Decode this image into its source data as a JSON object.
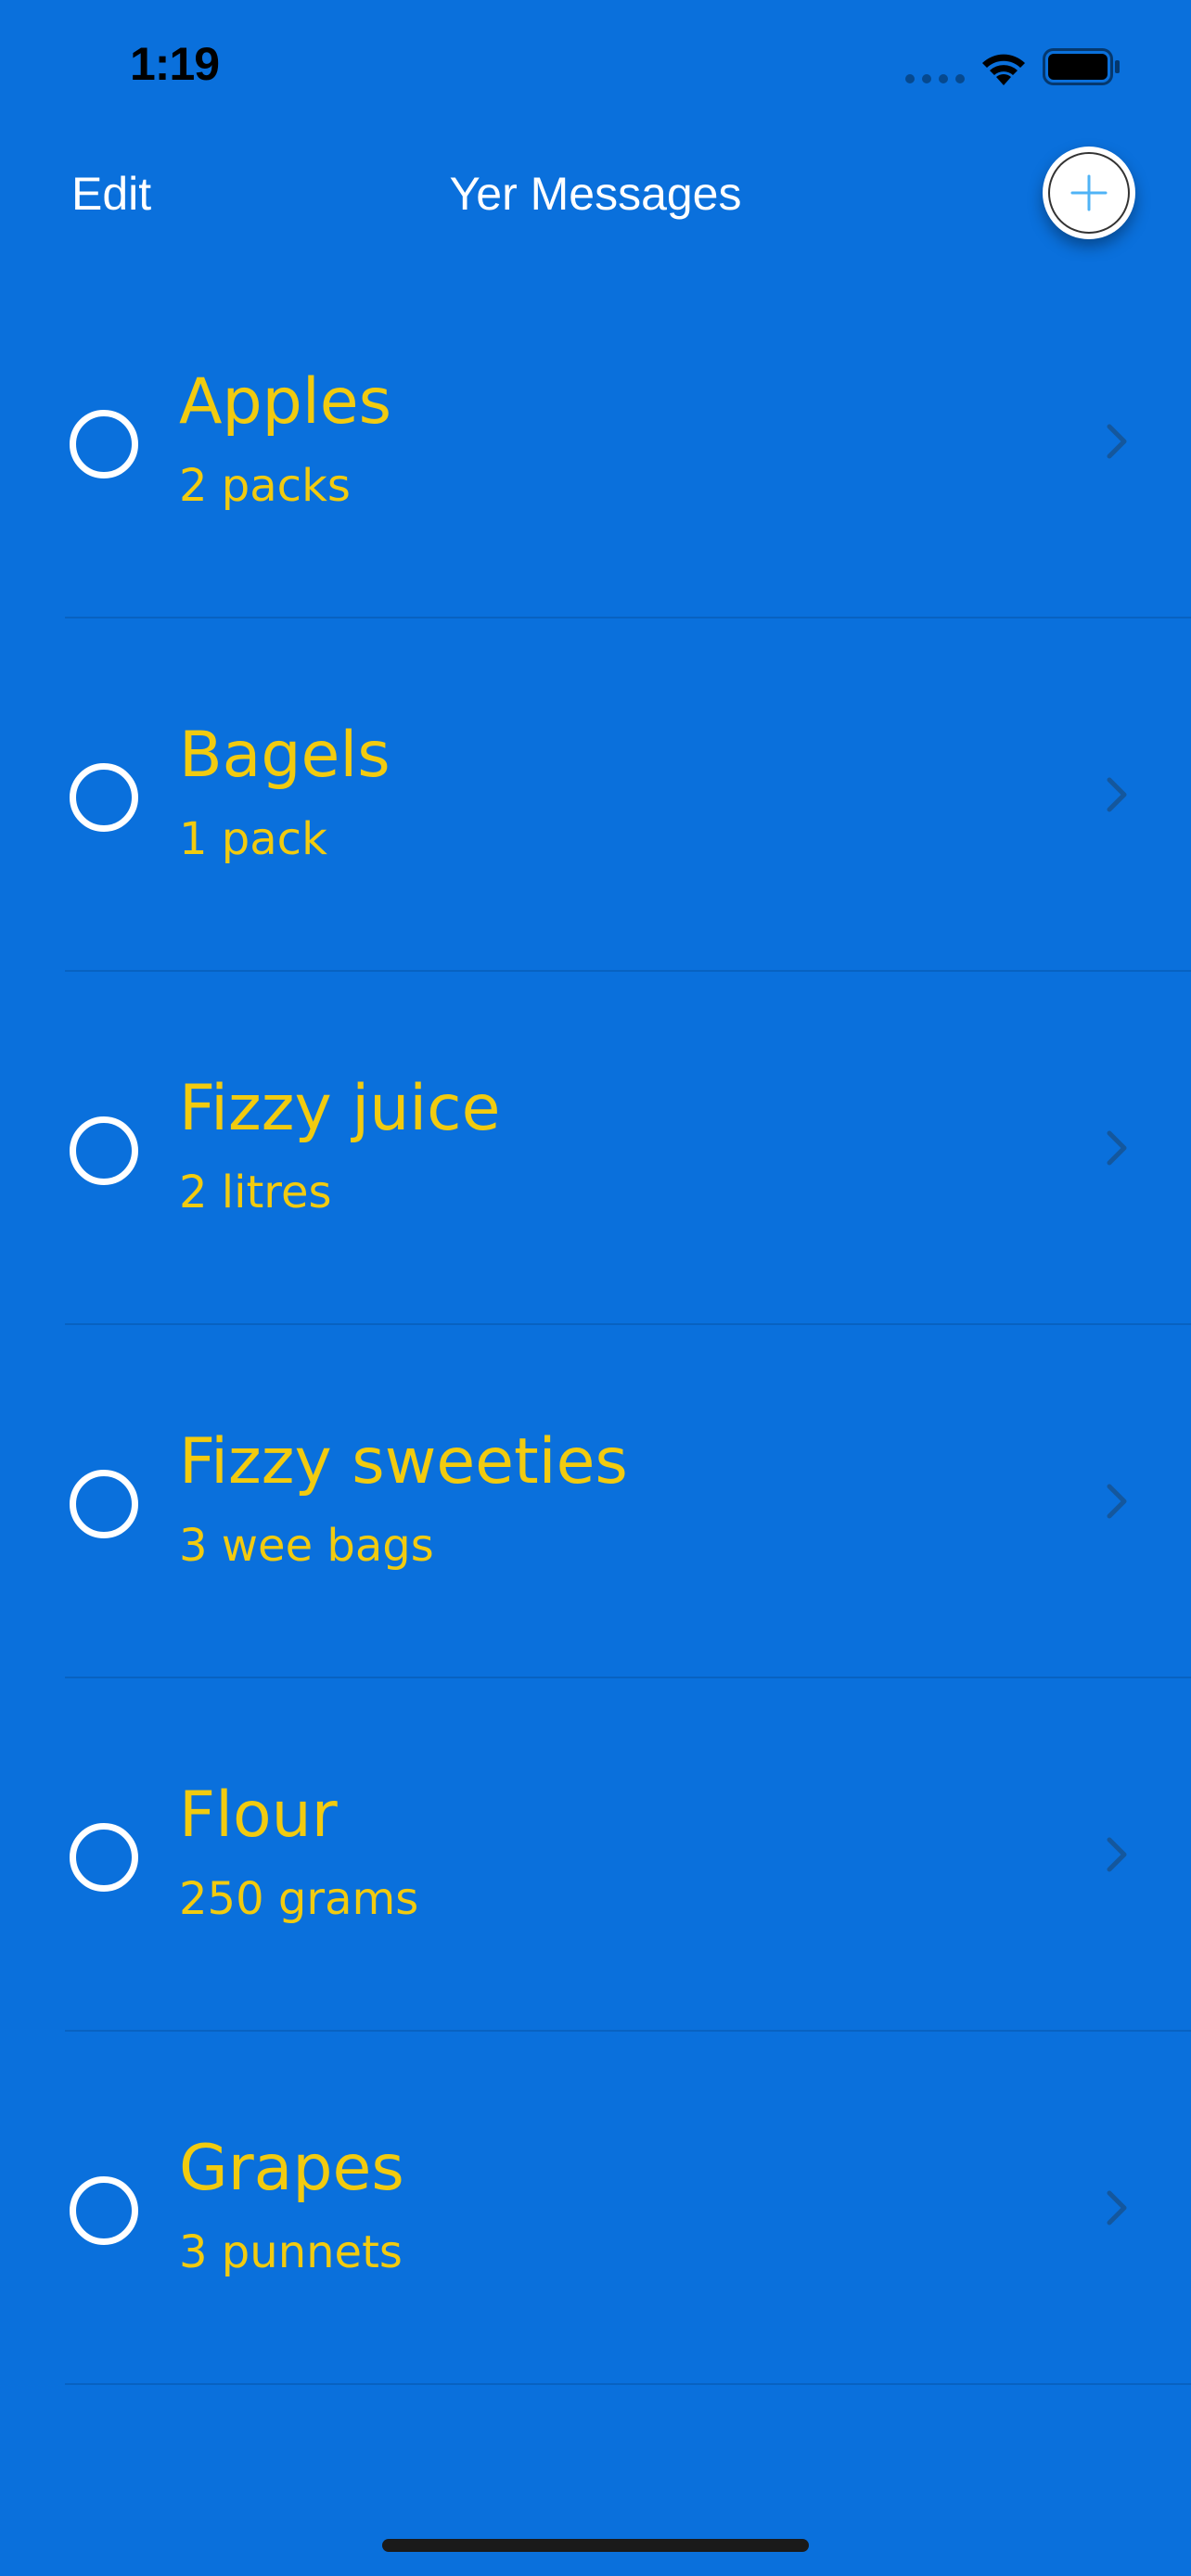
{
  "status_bar": {
    "time": "1:19"
  },
  "nav": {
    "edit_label": "Edit",
    "title": "Yer Messages",
    "add_icon": "plus-icon"
  },
  "colors": {
    "background": "#0A70DC",
    "item_text": "#F2CB0F",
    "nav_text": "#FFFFFF"
  },
  "items": [
    {
      "title": "Apples",
      "subtitle": "2 packs",
      "checked": false
    },
    {
      "title": "Bagels",
      "subtitle": "1 pack",
      "checked": false
    },
    {
      "title": "Fizzy juice",
      "subtitle": "2 litres",
      "checked": false
    },
    {
      "title": "Fizzy sweeties",
      "subtitle": "3 wee bags",
      "checked": false
    },
    {
      "title": "Flour",
      "subtitle": "250 grams",
      "checked": false
    },
    {
      "title": "Grapes",
      "subtitle": "3 punnets",
      "checked": false
    }
  ]
}
